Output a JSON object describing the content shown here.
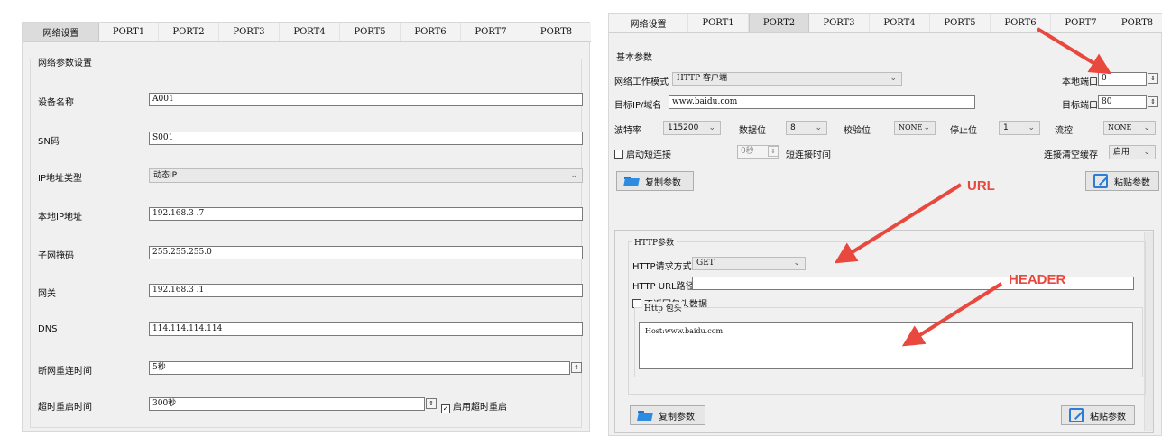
{
  "tabs": [
    "网络设置",
    "PORT1",
    "PORT2",
    "PORT3",
    "PORT4",
    "PORT5",
    "PORT6",
    "PORT7",
    "PORT8"
  ],
  "left": {
    "active_tab": "网络设置",
    "group_title": "网络参数设置",
    "rows": [
      {
        "label": "设备名称",
        "value": "A001"
      },
      {
        "label": "SN码",
        "value": "S001"
      },
      {
        "label": "IP地址类型",
        "value": "动态IP"
      },
      {
        "label": "本地IP地址",
        "value": "192.168.3  .7"
      },
      {
        "label": "子网掩码",
        "value": "255.255.255.0"
      },
      {
        "label": "网关",
        "value": "192.168.3  .1"
      },
      {
        "label": "DNS",
        "value": "114.114.114.114"
      },
      {
        "label": "断网重连时间",
        "value": "5秒"
      },
      {
        "label": "超时重启时间",
        "value": "300秒"
      }
    ],
    "timeout_restart_checkbox": "启用超时重启"
  },
  "right": {
    "active_tab": "PORT2",
    "basic_title": "基本参数",
    "work_mode_label": "网络工作模式",
    "work_mode_value": "HTTP 客户端",
    "local_port_label": "本地端口",
    "local_port_value": "0",
    "target_ip_label": "目标IP/域名",
    "target_ip_value": "www.baidu.com",
    "target_port_label": "目标端口",
    "target_port_value": "80",
    "baud_label": "波特率",
    "baud_value": "115200",
    "databits_label": "数据位",
    "databits_value": "8",
    "parity_label": "校验位",
    "parity_value": "NONE",
    "stopbits_label": "停止位",
    "stopbits_value": "1",
    "flow_label": "流控",
    "flow_value": "NONE",
    "short_conn_label": "启动短连接",
    "short_conn_value": "0秒",
    "short_conn_time_label": "短连接时间",
    "clear_cache_label": "连接清空缓存",
    "clear_cache_value": "启用",
    "copy_label": "复制参数",
    "paste_label": "粘贴参数",
    "http": {
      "title": "HTTP参数",
      "method_label": "HTTP请求方式",
      "method_value": "GET",
      "url_label": "HTTP URL路径",
      "url_value": "",
      "no_header_label": "不返回包头数据",
      "header_title": "Http 包头",
      "header_value": "Host:www.baidu.com",
      "copy_label": "复制参数",
      "paste_label": "粘贴参数"
    }
  },
  "annotations": {
    "url": "URL",
    "header": "HEADER",
    "color": "#e8483d"
  }
}
